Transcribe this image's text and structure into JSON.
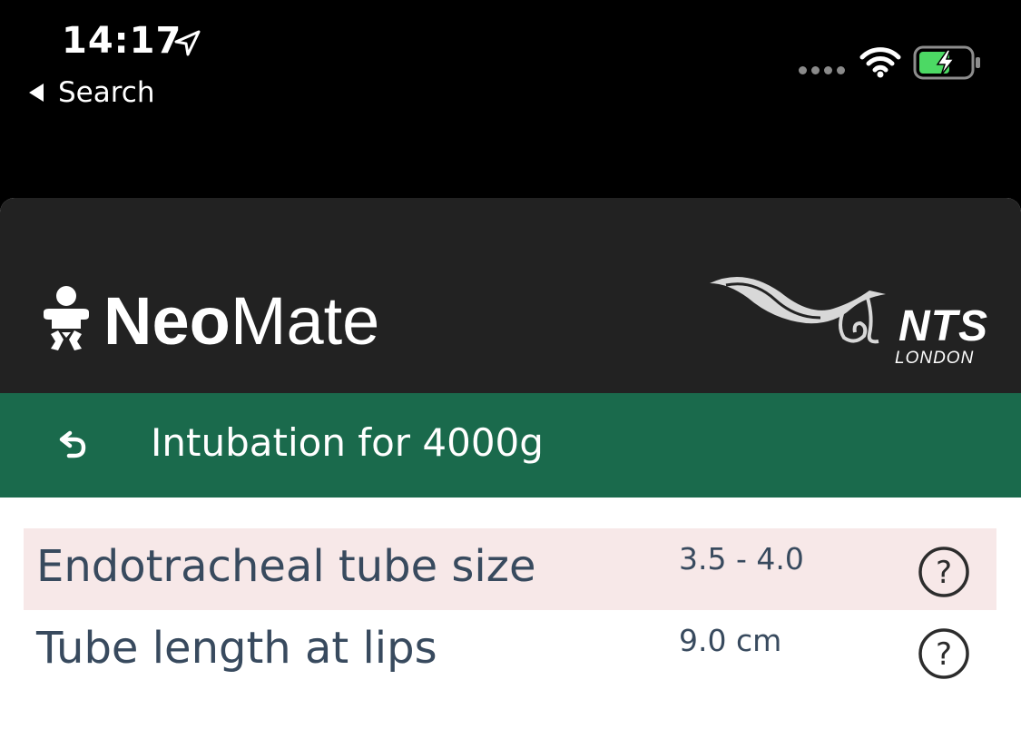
{
  "status_bar": {
    "time": "14:17",
    "back_label": "Search",
    "icons": [
      "location-arrow-icon",
      "signal-dots-icon",
      "wifi-icon",
      "battery-charging-icon"
    ]
  },
  "header": {
    "brand_bold": "Neo",
    "brand_light": "Mate",
    "partner": "NTS",
    "partner_sub": "LONDON",
    "background": "#222222"
  },
  "title_bar": {
    "title": "Intubation for 4000g",
    "background": "#1a6a4c",
    "icon": "undo-icon"
  },
  "results": [
    {
      "label": "Endotracheal tube size",
      "value": "3.5 - 4.0",
      "highlight": true
    },
    {
      "label": "Tube length at lips",
      "value": "9.0 cm",
      "highlight": false
    }
  ],
  "colors": {
    "text": "#384a5e",
    "highlight_row": "#f7e8e8",
    "battery_fill": "#4cd964"
  }
}
